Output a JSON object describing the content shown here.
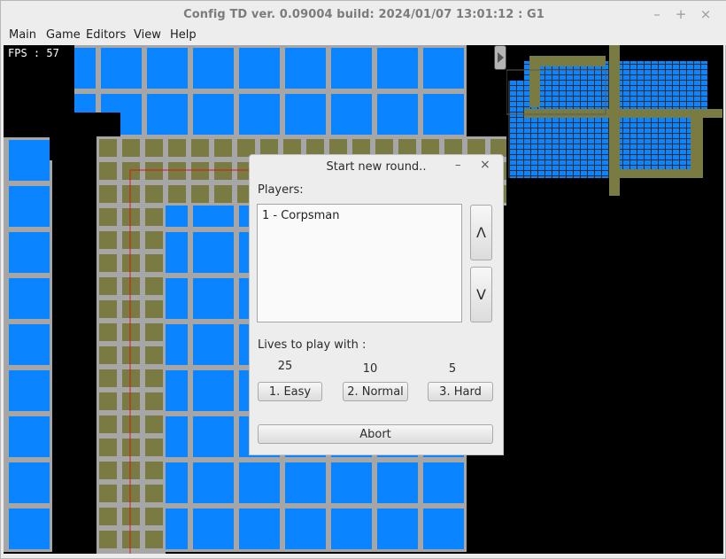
{
  "window": {
    "title": "Config TD ver. 0.09004 build: 2024/01/07  13:01:12 : G1",
    "minimize_glyph": "–",
    "maximize_glyph": "+",
    "close_glyph": "×"
  },
  "menu": [
    "Main",
    "Game",
    "Editors",
    "View",
    "Help"
  ],
  "game": {
    "fps_text": "FPS :  57",
    "colors": {
      "tile": "#0a84ff",
      "grid": "#a6a6a6",
      "path": "#7a7a43",
      "background": "#000000",
      "route_line": "#d11a1a"
    }
  },
  "dialog": {
    "title": "Start new round..",
    "minimize_glyph": "–",
    "close_glyph": "×",
    "players_label": "Players:",
    "players": [
      "1 - Corpsman"
    ],
    "move_up_label": "Λ",
    "move_down_label": "V",
    "lives_label": "Lives to play with :",
    "difficulties": [
      {
        "lives": "25",
        "label": "1. Easy"
      },
      {
        "lives": "10",
        "label": "2. Normal"
      },
      {
        "lives": "5",
        "label": "3. Hard"
      }
    ],
    "abort_label": "Abort"
  }
}
